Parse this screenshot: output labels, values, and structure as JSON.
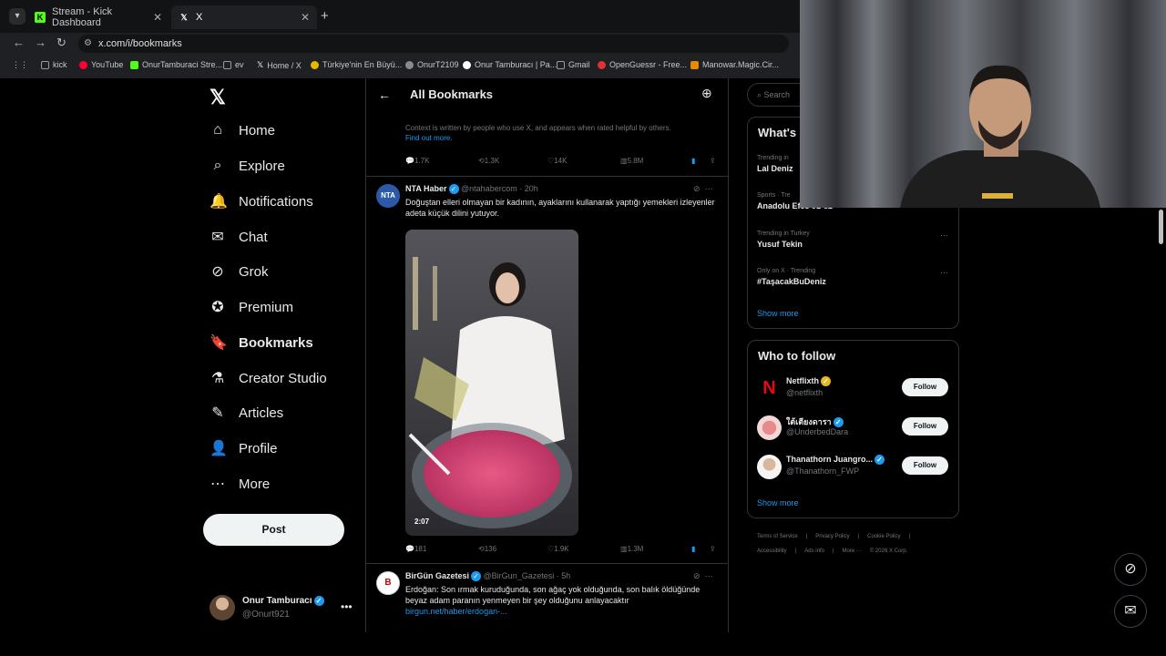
{
  "browser": {
    "tabs": [
      {
        "title": "Stream - Kick Dashboard",
        "favicon": "K",
        "color": "#53fc18"
      },
      {
        "title": "X",
        "favicon": "𝕏",
        "color": "#ffffff"
      }
    ],
    "url": "x.com/i/bookmarks",
    "bookmarks": [
      {
        "label": "kick",
        "icon": "folder-icon",
        "color": "#999999"
      },
      {
        "label": "YouTube",
        "icon": "youtube-icon",
        "color": "#ff0033"
      },
      {
        "label": "OnurTamburaci Stre...",
        "icon": "kick-icon",
        "color": "#53fc18"
      },
      {
        "label": "ev",
        "icon": "folder-icon",
        "color": "#999999"
      },
      {
        "label": "Home / X",
        "icon": "x-icon",
        "color": "#ffffff"
      },
      {
        "label": "Türkiye'nin En Büyü...",
        "icon": "site-icon",
        "color": "#e6b800"
      },
      {
        "label": "OnurT2109",
        "icon": "site-icon",
        "color": "#8a8a8a"
      },
      {
        "label": "Onur Tamburacı | Pa...",
        "icon": "site-icon",
        "color": "#ffffff"
      },
      {
        "label": "Gmail",
        "icon": "folder-icon",
        "color": "#999999"
      },
      {
        "label": "OpenGuessr - Free...",
        "icon": "site-icon",
        "color": "#e0303a"
      },
      {
        "label": "Manowar.Magic.Cir...",
        "icon": "site-icon",
        "color": "#e68a00"
      }
    ]
  },
  "nav": {
    "logo": "𝕏",
    "items": [
      {
        "label": "Home",
        "icon": "home-icon",
        "glyph": "⌂"
      },
      {
        "label": "Explore",
        "icon": "search-icon",
        "glyph": "⌕"
      },
      {
        "label": "Notifications",
        "icon": "bell-icon",
        "glyph": "🔔"
      },
      {
        "label": "Chat",
        "icon": "mail-icon",
        "glyph": "✉"
      },
      {
        "label": "Grok",
        "icon": "grok-icon",
        "glyph": "⊘"
      },
      {
        "label": "Premium",
        "icon": "verified-icon",
        "glyph": "✪"
      },
      {
        "label": "Bookmarks",
        "icon": "bookmark-icon",
        "glyph": "🔖"
      },
      {
        "label": "Creator Studio",
        "icon": "flask-icon",
        "glyph": "⚗"
      },
      {
        "label": "Articles",
        "icon": "article-icon",
        "glyph": "✎"
      },
      {
        "label": "Profile",
        "icon": "profile-icon",
        "glyph": "👤"
      },
      {
        "label": "More",
        "icon": "more-icon",
        "glyph": "⋯"
      }
    ],
    "active": "Bookmarks",
    "post_label": "Post",
    "account": {
      "name": "Onur Tamburacı",
      "handle": "@Onurt921"
    }
  },
  "feed": {
    "title": "All Bookmarks",
    "note_text": "Context is written by people who use X, and appears when rated helpful by others.",
    "note_link": "Find out more.",
    "top_actions": {
      "replies": "1.7K",
      "reposts": "1.3K",
      "likes": "14K",
      "views": "5.8M"
    },
    "tweets": [
      {
        "name": "NTA Haber",
        "handle": "@ntahabercom · 20h",
        "text": "Doğuştan elleri olmayan bir kadının, ayaklarını kullanarak yaptığı yemekleri izleyenler adeta küçük dilini yutuyor.",
        "video_duration": "2:07",
        "replies": "181",
        "reposts": "136",
        "likes": "1.9K",
        "views": "1.3M"
      },
      {
        "name": "BirGün Gazetesi",
        "handle": "@BirGun_Gazetesi · 5h",
        "text": "Erdoğan: Son ırmak kuruduğunda, son ağaç yok olduğunda, son balık öldüğünde beyaz adam paranın yenmeyen bir şey olduğunu anlayacaktır",
        "link": "birgun.net/haber/erdogan-..."
      }
    ]
  },
  "right": {
    "search_placeholder": "Search",
    "trends_title": "What's",
    "trends": [
      {
        "meta": "Trending in",
        "topic": "Lal Deniz"
      },
      {
        "meta": "Sports · Tre",
        "topic": "Anadolu Efes 91-82"
      },
      {
        "meta": "Trending in Turkey",
        "topic": "Yusuf Tekin"
      },
      {
        "meta": "Only on X · Trending",
        "topic": "#TaşacakBuDeniz"
      }
    ],
    "show_more": "Show more",
    "who_title": "Who to follow",
    "who": [
      {
        "name": "Netflixth",
        "handle": "@netflixth",
        "follow": "Follow"
      },
      {
        "name": "ใต้เตียงดารา",
        "handle": "@UnderbedDara",
        "follow": "Follow"
      },
      {
        "name": "Thanathorn Juangro...",
        "handle": "@Thanathorn_FWP",
        "follow": "Follow"
      }
    ],
    "footer": [
      "Terms of Service",
      "|",
      "Privacy Policy",
      "|",
      "Cookie Policy",
      "|",
      "Accessibility",
      "|",
      "Ads info",
      "|",
      "More ···",
      "© 2026 X Corp."
    ]
  }
}
